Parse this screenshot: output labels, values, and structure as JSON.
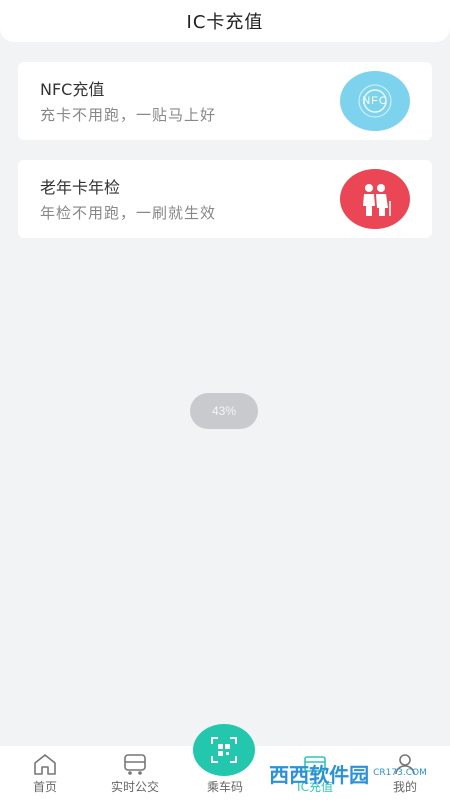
{
  "header": {
    "title": "IC卡充值"
  },
  "cards": [
    {
      "title": "NFC充值",
      "subtitle": "充卡不用跑，一贴马上好",
      "icon": "nfc-icon",
      "icon_text": "NFC",
      "color": "#7dd3ee"
    },
    {
      "title": "老年卡年检",
      "subtitle": "年检不用跑，一刷就生效",
      "icon": "elderly-couple-icon",
      "color": "#ea4655"
    }
  ],
  "loading": {
    "percent_text": "43%"
  },
  "tabbar": {
    "tabs": [
      {
        "label": "首页",
        "icon": "home-icon"
      },
      {
        "label": "实时公交",
        "icon": "bus-icon"
      },
      {
        "label": "乘车码",
        "icon": "qr-code-icon"
      },
      {
        "label": "IC充值",
        "icon": "card-icon",
        "active": true
      },
      {
        "label": "我的",
        "icon": "user-icon"
      }
    ],
    "accent": "#23c7ae"
  },
  "watermark": {
    "text": "西西软件园",
    "sub": "CR173.COM"
  }
}
